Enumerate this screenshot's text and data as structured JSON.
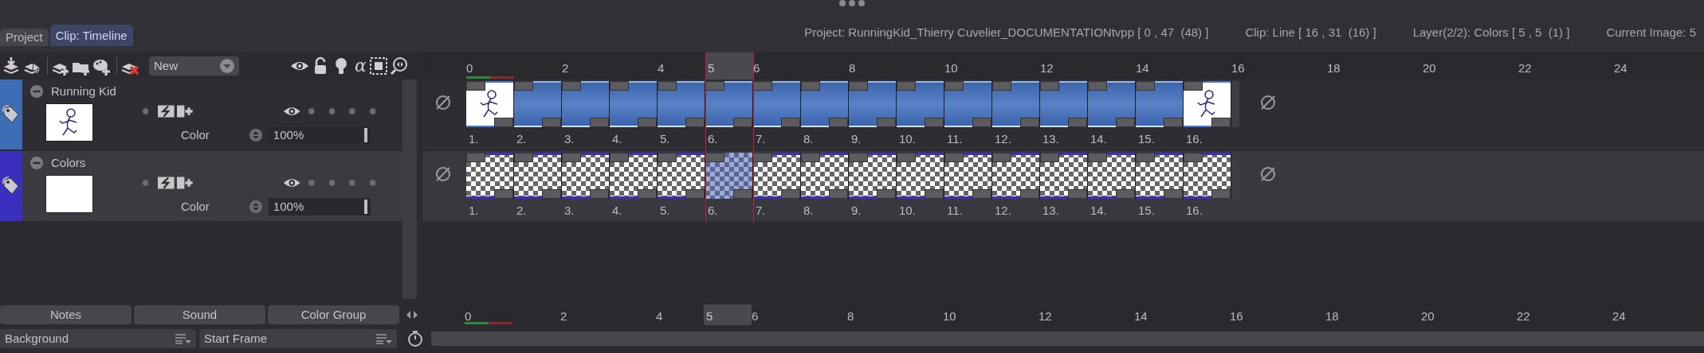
{
  "header": {
    "tabs": [
      {
        "label": "Project",
        "selected": false
      },
      {
        "label": "Clip: Timeline",
        "selected": true
      }
    ],
    "info": [
      "Project: RunningKid_Thierry Cuvelier_DOCUMENTATIONtvpp [ 0 , 47  (48) ]",
      "Clip: Line [ 16 , 31  (16) ]",
      "Layer(2/2): Colors [ 5 , 5  (1) ]",
      "Current Image: 5"
    ]
  },
  "toolbar": {
    "preset": "New",
    "alpha_toggle": "α"
  },
  "ruler": {
    "labels": [
      "0",
      "2",
      "4",
      "6",
      "8",
      "10",
      "12",
      "14",
      "16",
      "18",
      "20",
      "22",
      "24"
    ],
    "current": "5"
  },
  "layers": [
    {
      "name": "Running Kid",
      "color": "#3e6db6",
      "selected": false,
      "thumbnail_drawn": true,
      "blend": "Color",
      "opacity": "100%",
      "frames": [
        {
          "label": "1.",
          "kind": "drawing",
          "selected": false
        },
        {
          "label": "2.",
          "kind": "fill",
          "selected": false
        },
        {
          "label": "3.",
          "kind": "fill",
          "selected": false
        },
        {
          "label": "4.",
          "kind": "fill",
          "selected": false
        },
        {
          "label": "5.",
          "kind": "fill",
          "selected": false
        },
        {
          "label": "6.",
          "kind": "fill",
          "selected": false
        },
        {
          "label": "7.",
          "kind": "fill",
          "selected": false
        },
        {
          "label": "8.",
          "kind": "fill",
          "selected": false
        },
        {
          "label": "9.",
          "kind": "fill",
          "selected": false
        },
        {
          "label": "10.",
          "kind": "fill",
          "selected": false
        },
        {
          "label": "11.",
          "kind": "fill",
          "selected": false
        },
        {
          "label": "12.",
          "kind": "fill",
          "selected": false
        },
        {
          "label": "13.",
          "kind": "fill",
          "selected": false
        },
        {
          "label": "14.",
          "kind": "fill",
          "selected": false
        },
        {
          "label": "15.",
          "kind": "fill",
          "selected": false
        },
        {
          "label": "16.",
          "kind": "drawing",
          "selected": false
        }
      ]
    },
    {
      "name": "Colors",
      "color": "#3b2fc0",
      "selected": true,
      "thumbnail_drawn": false,
      "blend": "Color",
      "opacity": "100%",
      "frames": [
        {
          "label": "1.",
          "kind": "transparent",
          "selected": false
        },
        {
          "label": "2.",
          "kind": "transparent",
          "selected": false
        },
        {
          "label": "3.",
          "kind": "transparent",
          "selected": false
        },
        {
          "label": "4.",
          "kind": "transparent",
          "selected": false
        },
        {
          "label": "5.",
          "kind": "transparent",
          "selected": false
        },
        {
          "label": "6.",
          "kind": "transparent",
          "selected": true
        },
        {
          "label": "7.",
          "kind": "transparent",
          "selected": false
        },
        {
          "label": "8.",
          "kind": "transparent",
          "selected": false
        },
        {
          "label": "9.",
          "kind": "transparent",
          "selected": false
        },
        {
          "label": "10.",
          "kind": "transparent",
          "selected": false
        },
        {
          "label": "11.",
          "kind": "transparent",
          "selected": false
        },
        {
          "label": "12.",
          "kind": "transparent",
          "selected": false
        },
        {
          "label": "13.",
          "kind": "transparent",
          "selected": false
        },
        {
          "label": "14.",
          "kind": "transparent",
          "selected": false
        },
        {
          "label": "15.",
          "kind": "transparent",
          "selected": false
        },
        {
          "label": "16.",
          "kind": "transparent",
          "selected": false
        }
      ]
    }
  ],
  "bottom_buttons": [
    "Notes",
    "Sound",
    "Color Group"
  ],
  "bottom_ruler": {
    "labels": [
      "0",
      "2",
      "4",
      "6",
      "8",
      "10",
      "12",
      "14",
      "16",
      "18",
      "20",
      "22",
      "24"
    ],
    "current": "5"
  },
  "dropdowns": [
    "Background",
    "Start Frame"
  ]
}
